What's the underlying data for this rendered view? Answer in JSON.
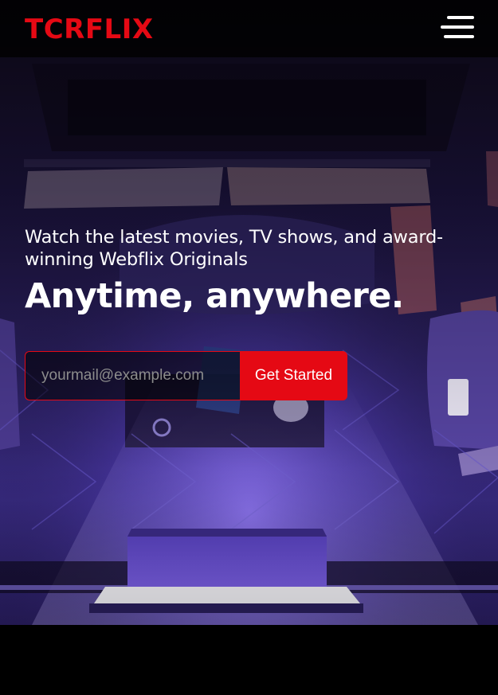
{
  "brand": {
    "name": "TCRFLIX",
    "accent_color": "#e50914"
  },
  "nav": {
    "menu_icon": "hamburger-menu-icon"
  },
  "hero": {
    "tagline": "Watch the latest movies, TV shows, and award-winning Webflix Originals",
    "headline": "Anytime, anywhere.",
    "background": "living-room-illustration"
  },
  "signup": {
    "email_placeholder": "yourmail@example.com",
    "email_value": "",
    "button_label": "Get Started"
  }
}
